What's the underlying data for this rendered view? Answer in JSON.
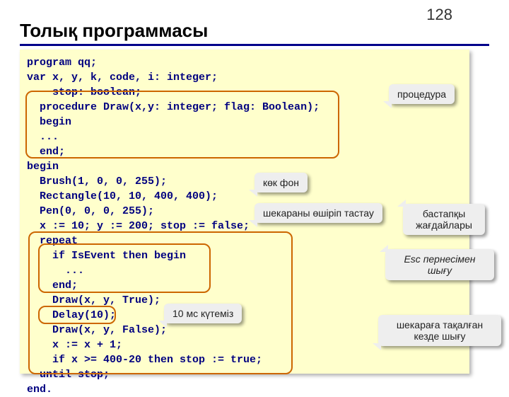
{
  "page_number": "128",
  "title": "Толық программасы",
  "code": {
    "l01": "program qq;",
    "l02": "var x, y, k, code, i: integer;",
    "l03": "    stop: boolean;",
    "l04": "  procedure Draw(x,y: integer; flag: Boolean);",
    "l05": "  begin",
    "l06": "  ...",
    "l07": "  end;",
    "l08": "begin",
    "l09": "  Brush(1, 0, 0, 255);",
    "l10": "  Rectangle(10, 10, 400, 400);",
    "l11": "  Pen(0, 0, 0, 255);",
    "l12": "  x := 10; y := 200; stop := false;",
    "l13": "  repeat",
    "l14": "    if IsEvent then begin",
    "l15": "      ...",
    "l16": "    end;",
    "l17": "    Draw(x, y, True);",
    "l18": "    Delay(10);",
    "l19": "    Draw(x, y, False);",
    "l20": "    x := x + 1;",
    "l21": "    if x >= 400-20 then stop := true;",
    "l22": "  until stop;",
    "l23": "end."
  },
  "callouts": {
    "procedure": "процедура",
    "blue_bg": "көк фон",
    "erase_border": "шекараны өшіріп тастау",
    "initial_cond_l1": "бастапқы",
    "initial_cond_l2": "жағдайлары",
    "esc_exit_l1": "Esc пернесімен",
    "esc_exit_l2": "шығу",
    "wait_10ms": "10 мс күтеміз",
    "border_stuck_l1": "шекараға тақалған",
    "border_stuck_l2": "кезде шығу"
  }
}
